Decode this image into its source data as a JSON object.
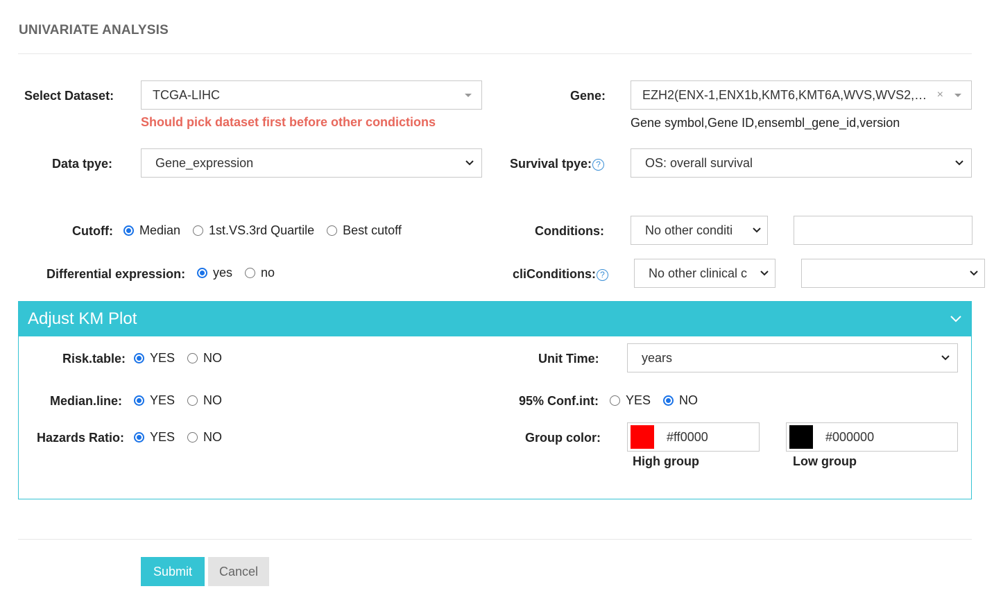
{
  "page": {
    "title": "UNIVARIATE ANALYSIS"
  },
  "dataset": {
    "label": "Select Dataset:",
    "value": "TCGA-LIHC",
    "warning": "Should pick dataset first before other condictions"
  },
  "gene": {
    "label": "Gene:",
    "value": "EZH2(ENX-1,ENX1b,KMT6,KMT6A,WVS,WVS2,EZ...",
    "clear": "×",
    "hint": "Gene symbol,Gene ID,ensembl_gene_id,version"
  },
  "data_type": {
    "label": "Data tpye:",
    "value": "Gene_expression"
  },
  "survival_type": {
    "label": "Survival tpye:",
    "help": "?",
    "value": "OS: overall survival"
  },
  "cutoff": {
    "label": "Cutoff:",
    "options": [
      {
        "label": "Median",
        "selected": true
      },
      {
        "label": "1st.VS.3rd Quartile",
        "selected": false
      },
      {
        "label": "Best cutoff",
        "selected": false
      }
    ]
  },
  "conditions": {
    "label": "Conditions:",
    "select_value": "No other conditi",
    "input_value": ""
  },
  "diff_expr": {
    "label": "Differential expression:",
    "options": [
      {
        "label": "yes",
        "selected": true
      },
      {
        "label": "no",
        "selected": false
      }
    ]
  },
  "cli_conditions": {
    "label": "cliConditions:",
    "help": "?",
    "select_value": "No other clinical c",
    "second_value": ""
  },
  "km_panel": {
    "title": "Adjust KM Plot",
    "risk_table": {
      "label": "Risk.table:",
      "yes": "YES",
      "no": "NO",
      "selected": "YES"
    },
    "median_line": {
      "label": "Median.line:",
      "yes": "YES",
      "no": "NO",
      "selected": "YES"
    },
    "hazards_ratio": {
      "label": "Hazards Ratio:",
      "yes": "YES",
      "no": "NO",
      "selected": "YES"
    },
    "unit_time": {
      "label": "Unit Time:",
      "value": "years"
    },
    "conf_int": {
      "label": "95% Conf.int:",
      "yes": "YES",
      "no": "NO",
      "selected": "NO"
    },
    "group_color": {
      "label": "Group color:",
      "high": {
        "hex": "#ff0000",
        "caption": "High group"
      },
      "low": {
        "hex": "#000000",
        "caption": "Low group"
      }
    }
  },
  "actions": {
    "submit": "Submit",
    "cancel": "Cancel"
  },
  "colors": {
    "accent": "#35c4d4",
    "warning": "#e8685c",
    "radio": "#1a73e8"
  }
}
